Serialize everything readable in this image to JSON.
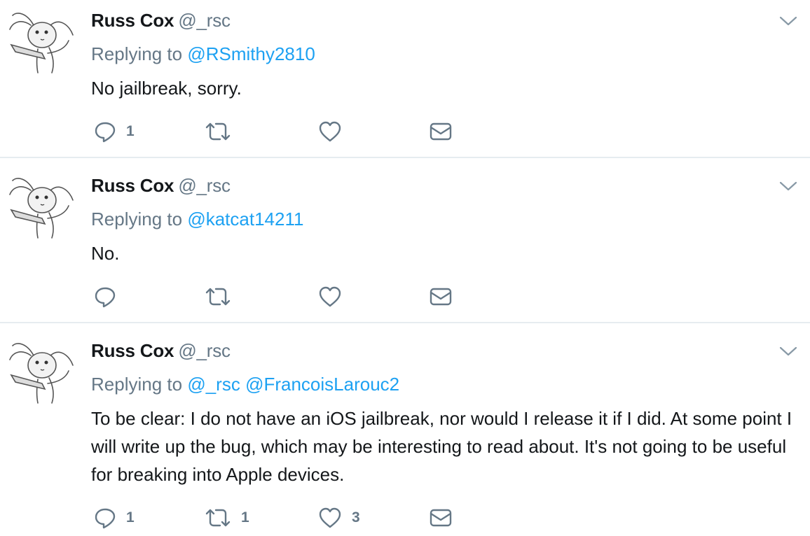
{
  "tweets": [
    {
      "author": "Russ Cox",
      "handle": "@_rsc",
      "replying_prefix": "Replying to",
      "mentions": [
        "@RSmithy2810"
      ],
      "text": "No jailbreak, sorry.",
      "reply_count": "1",
      "retweet_count": "",
      "like_count": ""
    },
    {
      "author": "Russ Cox",
      "handle": "@_rsc",
      "replying_prefix": "Replying to",
      "mentions": [
        "@katcat14211"
      ],
      "text": "No.",
      "reply_count": "",
      "retweet_count": "",
      "like_count": ""
    },
    {
      "author": "Russ Cox",
      "handle": "@_rsc",
      "replying_prefix": "Replying to",
      "mentions": [
        "@_rsc",
        "@FrancoisLarouc2"
      ],
      "text": "To be clear: I do not have an iOS jailbreak, nor would I release it if I did. At some point I will write up the bug, which may be interesting to read about. It's not going to be useful for breaking into Apple devices.",
      "reply_count": "1",
      "retweet_count": "1",
      "like_count": "3"
    }
  ],
  "icons": {
    "avatar": "cartoon-rabbit-avatar",
    "caret": "chevron-down-icon",
    "reply": "reply-icon",
    "retweet": "retweet-icon",
    "like": "heart-icon",
    "dm": "envelope-icon"
  },
  "colors": {
    "text": "#14171a",
    "muted": "#657786",
    "link": "#1da1f2",
    "divider": "#e6ecf0"
  }
}
